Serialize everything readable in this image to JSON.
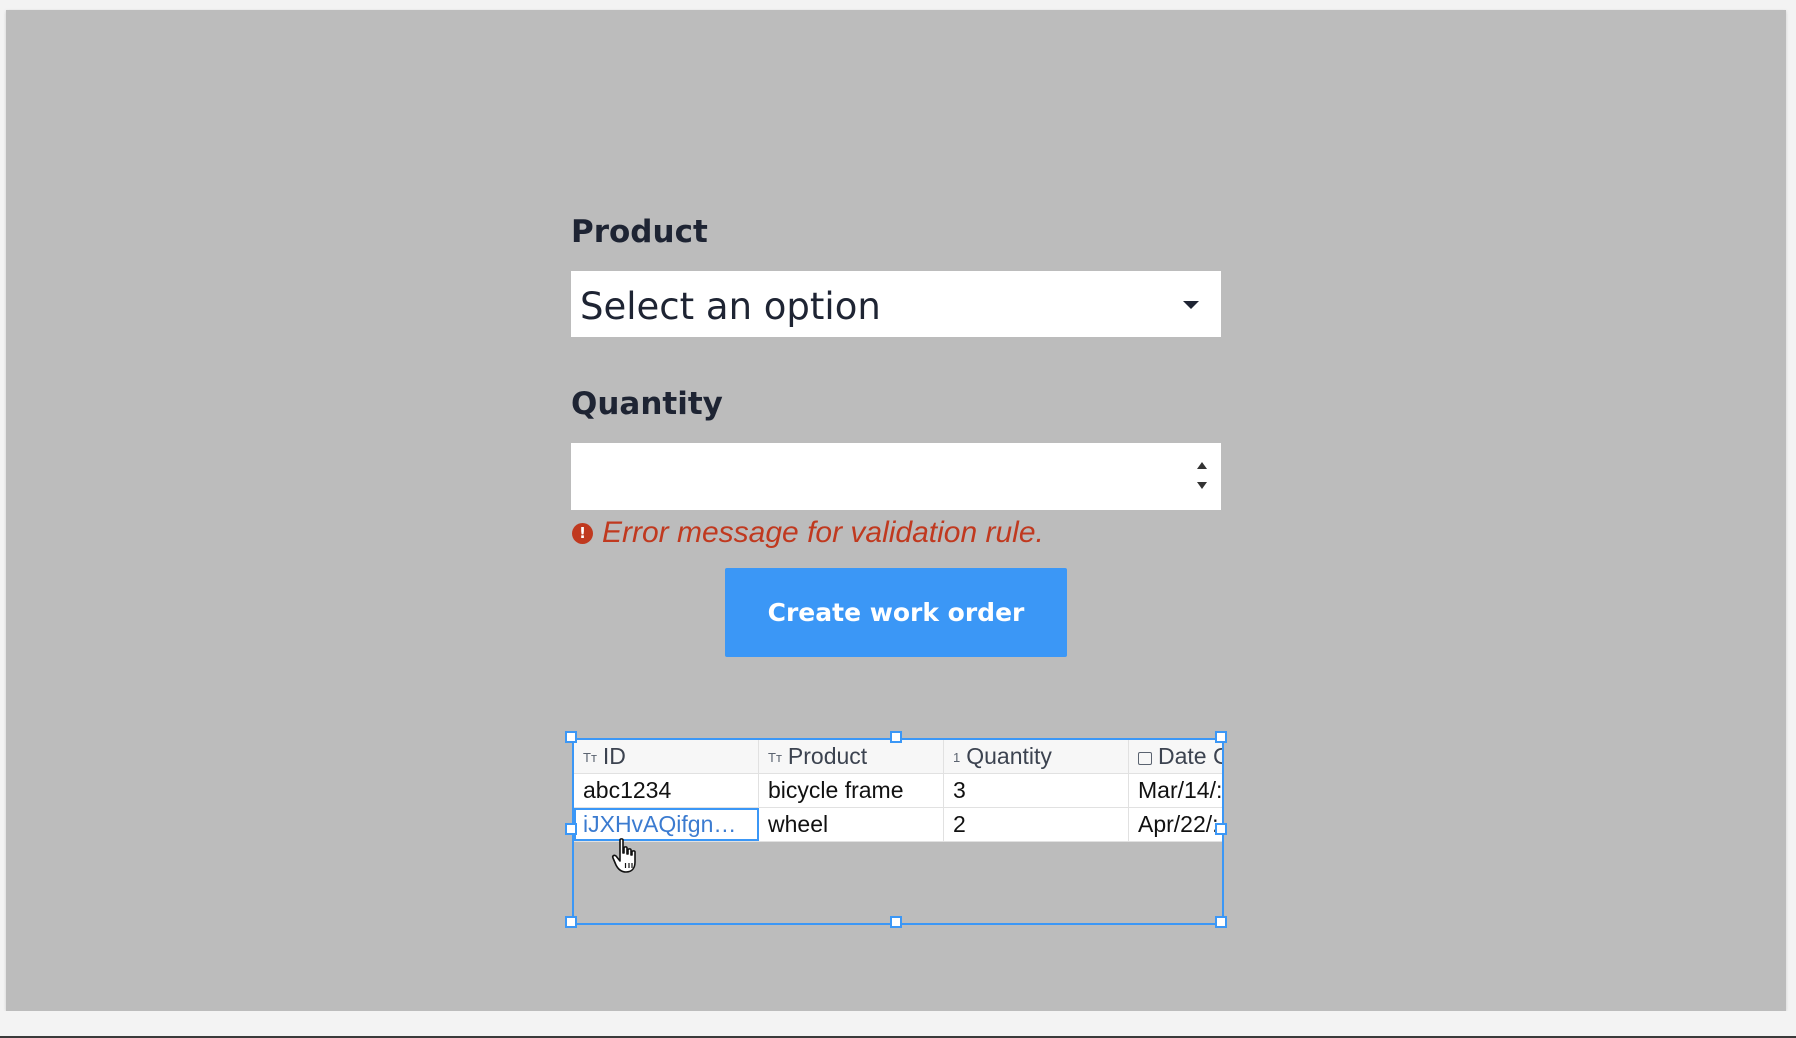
{
  "form": {
    "product_label": "Product",
    "product_select": {
      "value": "Select an option",
      "icon": "chevron-down-icon"
    },
    "quantity_label": "Quantity",
    "quantity_input": {
      "value": ""
    },
    "error": {
      "icon": "error-icon",
      "icon_glyph": "!",
      "message": "Error message for validation rule."
    },
    "submit_label": "Create work order"
  },
  "table": {
    "columns": [
      {
        "label": "ID",
        "type_icon": "Tт"
      },
      {
        "label": "Product",
        "type_icon": "Tт"
      },
      {
        "label": "Quantity",
        "type_icon": "1"
      },
      {
        "label": "Date C",
        "type_icon": "calendar-icon"
      }
    ],
    "rows": [
      [
        "abc1234",
        "bicycle frame",
        "3",
        "Mar/14/:"
      ],
      [
        "iJXHvAQifgn…",
        "wheel",
        "2",
        "Apr/22/:"
      ]
    ],
    "selected_cell": {
      "row": 2,
      "column": 1
    }
  },
  "colors": {
    "canvas": "#bcbcbc",
    "accent": "#3b97f6",
    "error": "#c0391f",
    "label": "#1e2433"
  }
}
